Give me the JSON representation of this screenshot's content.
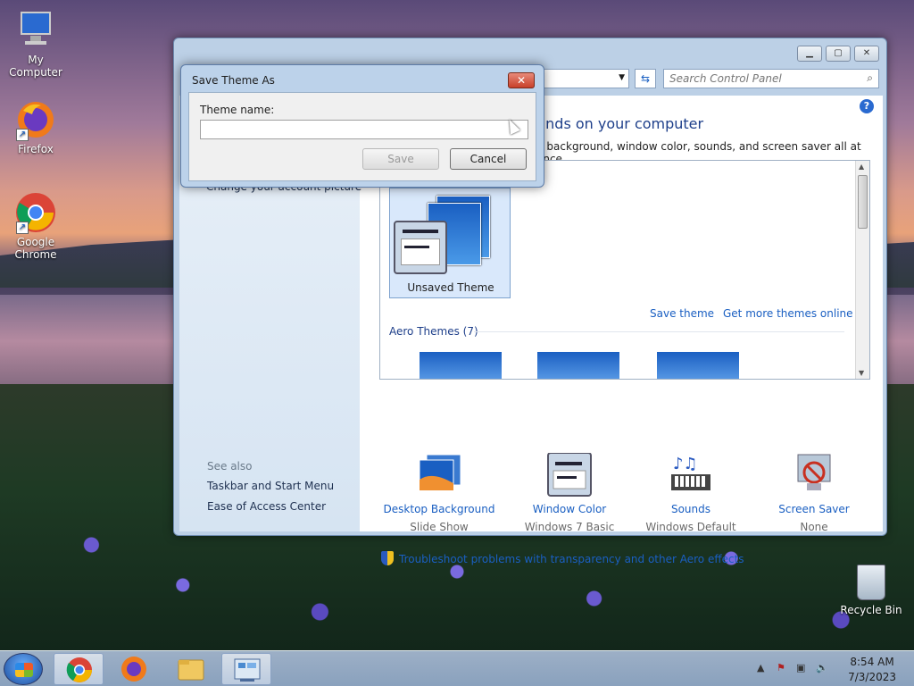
{
  "desktop": {
    "icons": [
      {
        "label": "My Computer"
      },
      {
        "label": "Firefox"
      },
      {
        "label": "Google Chrome"
      }
    ],
    "recycle_bin": "Recycle Bin"
  },
  "control_panel": {
    "search_placeholder": "Search Control Panel",
    "heading": "unds on your computer",
    "subheading": "p background, window color, sounds, and screen saver all at once.",
    "left_links": {
      "change_picture": "Change your account picture"
    },
    "see_also": {
      "label": "See also",
      "items": [
        "Taskbar and Start Menu",
        "Ease of Access Center"
      ]
    },
    "themes": {
      "unsaved_label": "Unsaved Theme",
      "save_theme": "Save theme",
      "get_more": "Get more themes online",
      "aero_label": "Aero Themes (7)"
    },
    "bottom_items": [
      {
        "title": "Desktop Background",
        "sub": "Slide Show"
      },
      {
        "title": "Window Color",
        "sub": "Windows 7 Basic"
      },
      {
        "title": "Sounds",
        "sub": "Windows Default"
      },
      {
        "title": "Screen Saver",
        "sub": "None"
      }
    ],
    "troubleshoot": "Troubleshoot problems with transparency and other Aero effects"
  },
  "dialog": {
    "title": "Save Theme As",
    "label": "Theme name:",
    "value": "",
    "save_label": "Save",
    "cancel_label": "Cancel"
  },
  "taskbar": {
    "time": "8:54 AM",
    "date": "7/3/2023"
  }
}
